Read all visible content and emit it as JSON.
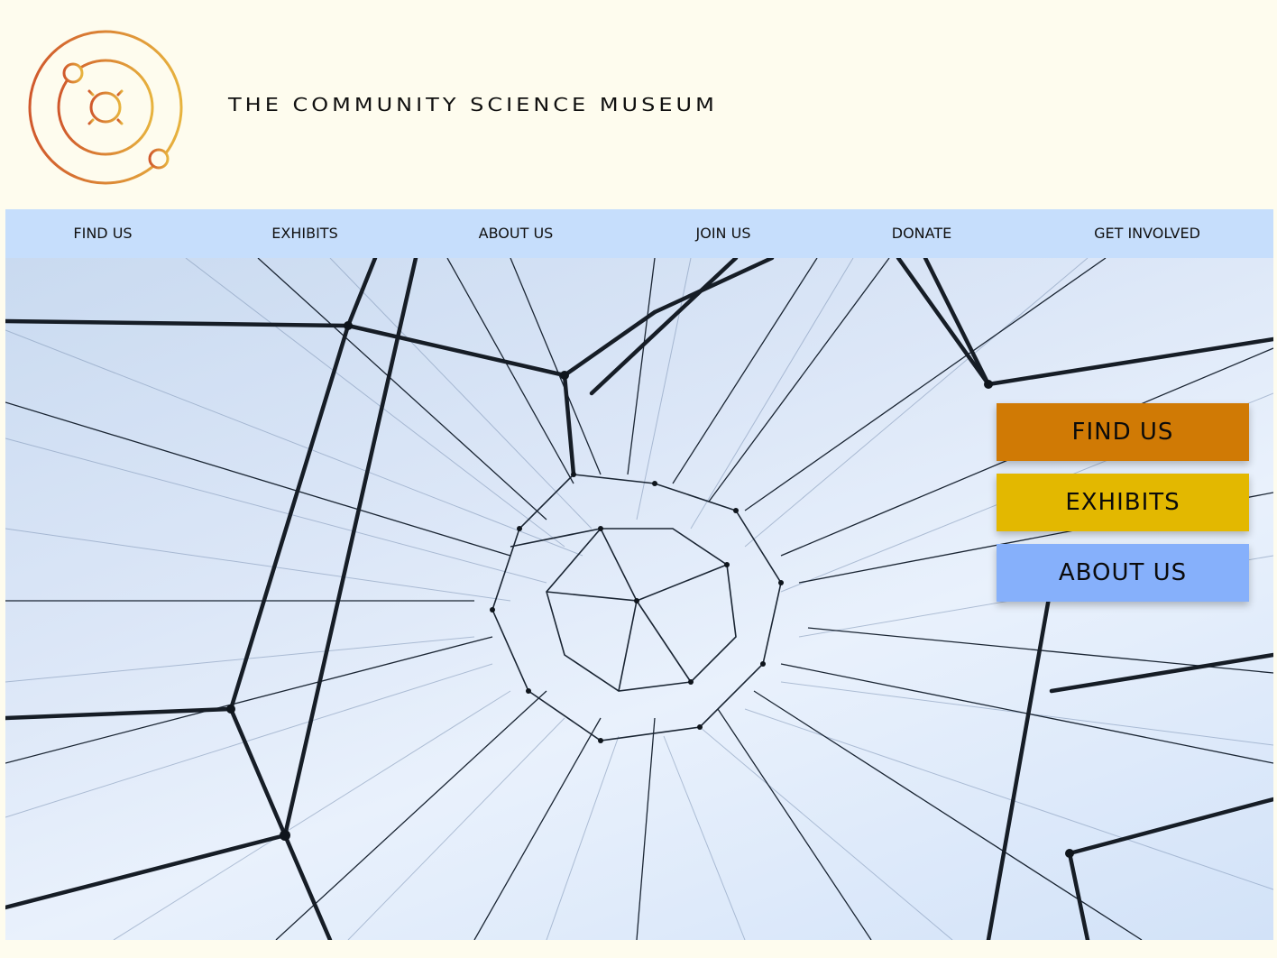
{
  "header": {
    "title": "THE COMMUNITY SCIENCE MUSEUM",
    "logo_icon": "orbit-sun-logo-icon"
  },
  "nav": {
    "items": [
      {
        "label": "FIND US"
      },
      {
        "label": "EXHIBITS"
      },
      {
        "label": "ABOUT US"
      },
      {
        "label": "JOIN US"
      },
      {
        "label": "DONATE"
      },
      {
        "label": "GET INVOLVED"
      }
    ]
  },
  "hero": {
    "image": "wire-network-sculpture",
    "buttons": [
      {
        "label": "FIND US",
        "color": "#d07a05"
      },
      {
        "label": "EXHIBITS",
        "color": "#e3b800"
      },
      {
        "label": "ABOUT US",
        "color": "#86b0fb"
      }
    ]
  },
  "colors": {
    "page_bg": "#fefcee",
    "nav_bg": "#c6defc",
    "logo_gradient_start": "#d0582c",
    "logo_gradient_end": "#e7b33e"
  }
}
